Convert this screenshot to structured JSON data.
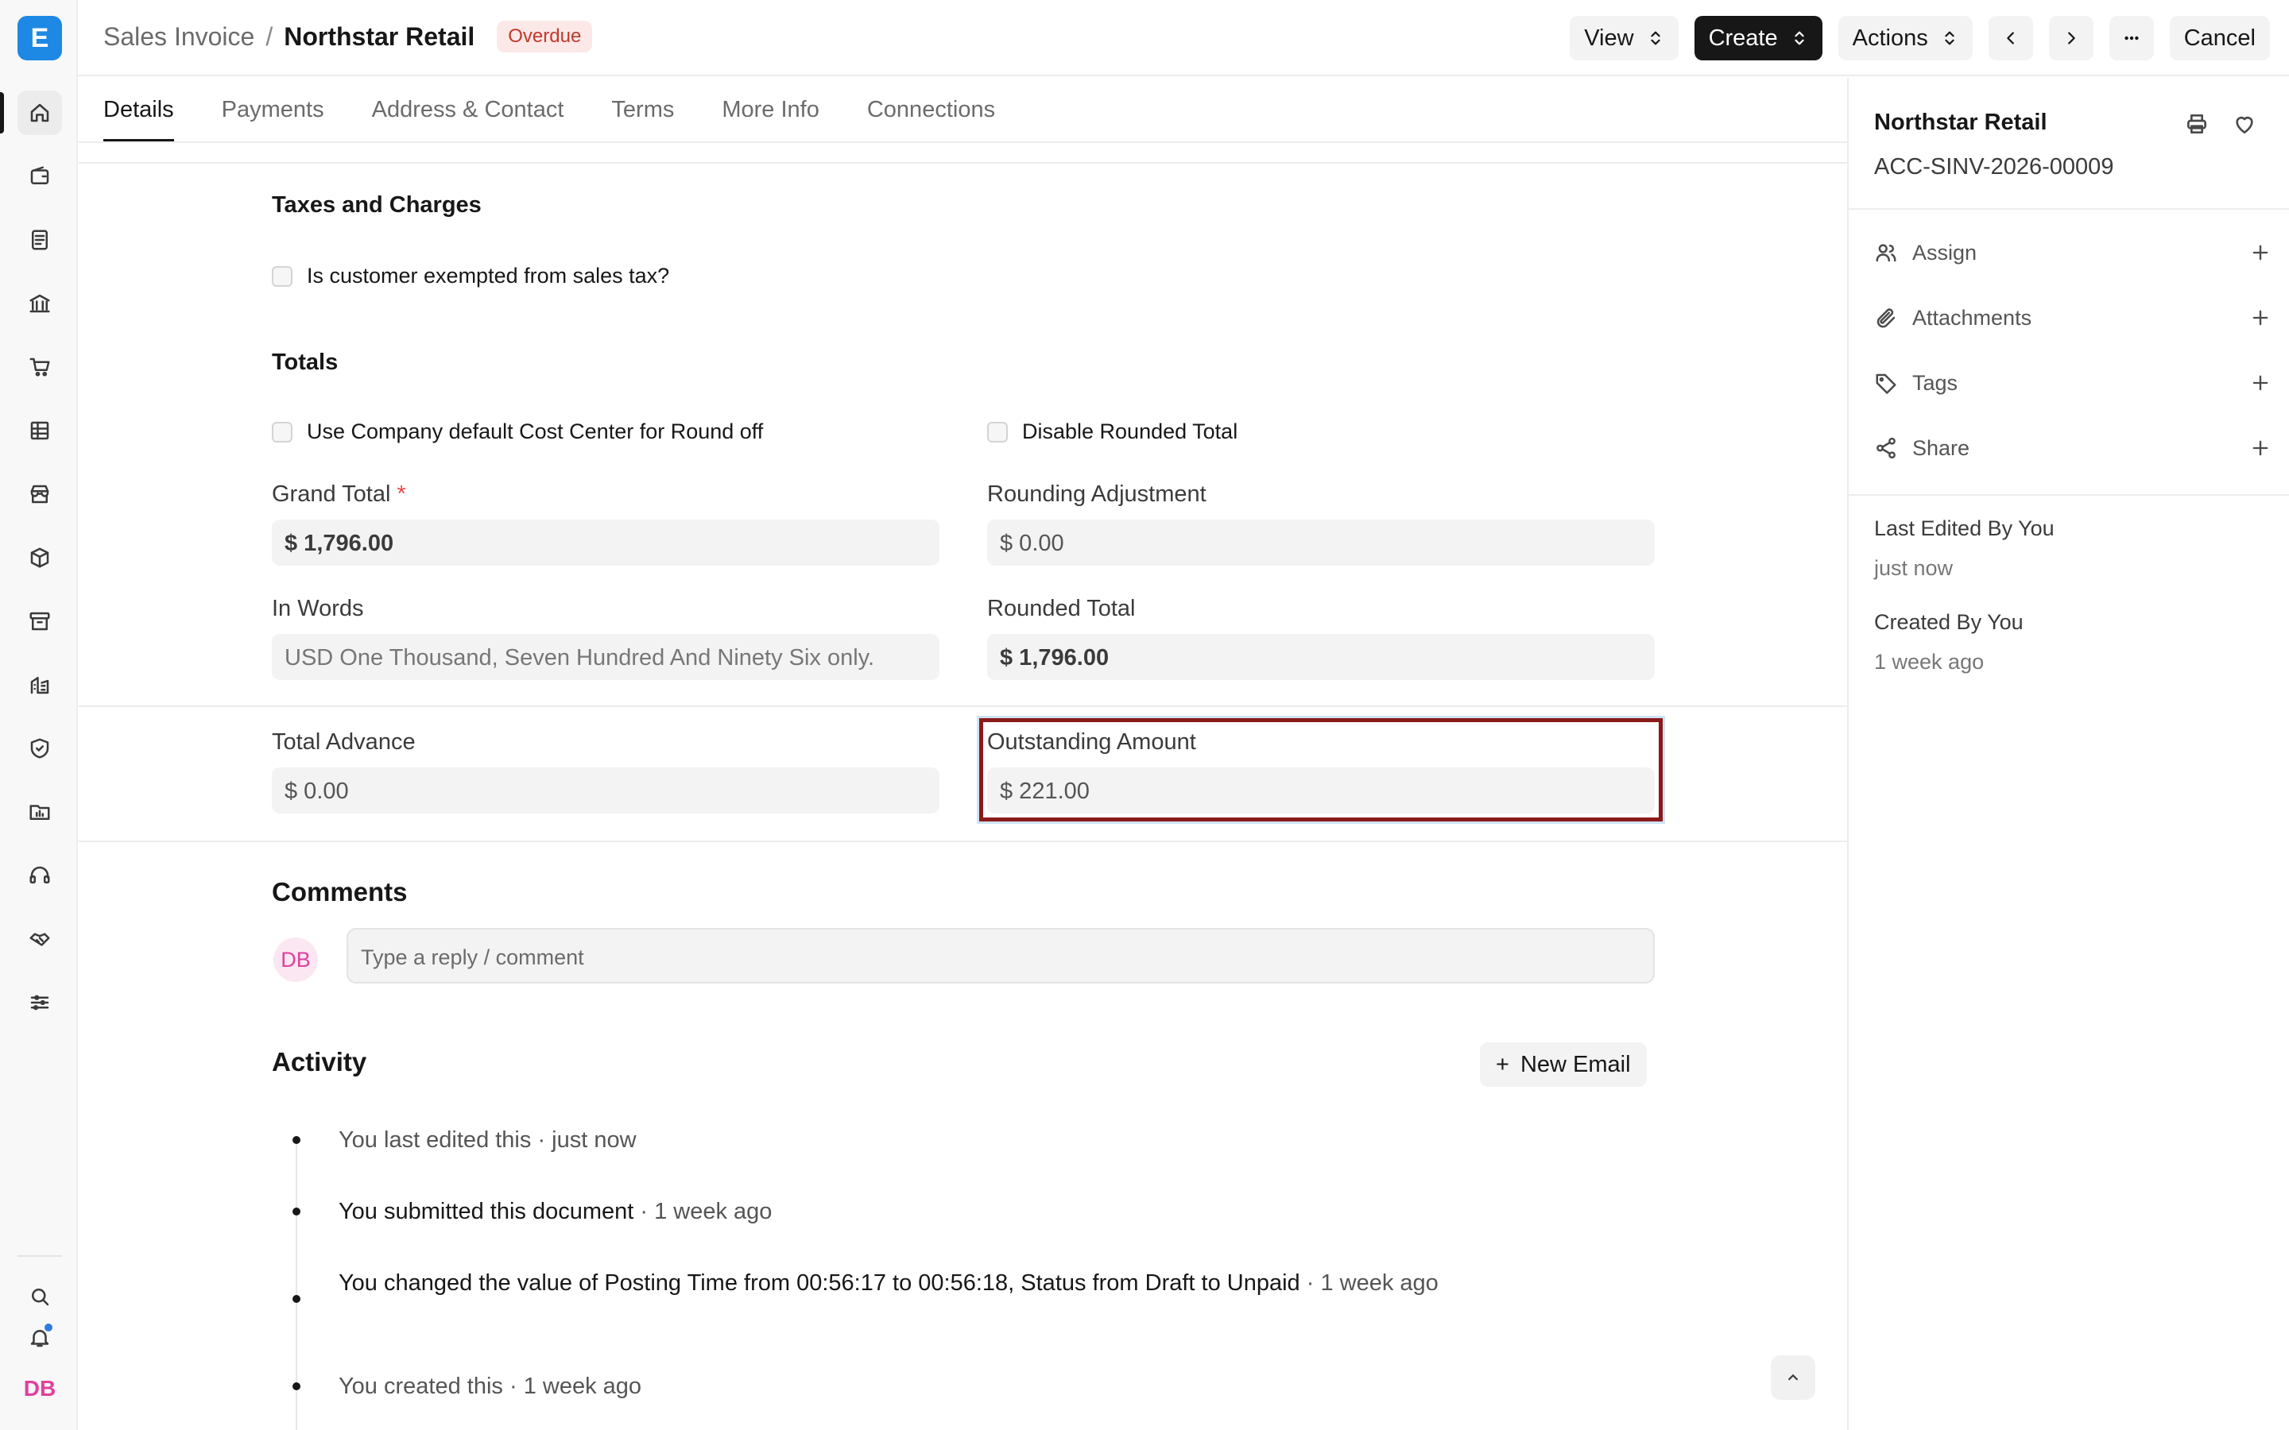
{
  "app": {
    "logo_letter": "E"
  },
  "header": {
    "breadcrumb_parent": "Sales Invoice",
    "breadcrumb_separator": "/",
    "title": "Northstar Retail",
    "status_badge": "Overdue",
    "buttons": {
      "view": "View",
      "create": "Create",
      "actions": "Actions",
      "cancel": "Cancel"
    }
  },
  "tabs": [
    {
      "label": "Details",
      "active": true
    },
    {
      "label": "Payments"
    },
    {
      "label": "Address & Contact"
    },
    {
      "label": "Terms"
    },
    {
      "label": "More Info"
    },
    {
      "label": "Connections"
    }
  ],
  "taxes": {
    "heading": "Taxes and Charges",
    "exempt_checkbox": "Is customer exempted from sales tax?"
  },
  "totals": {
    "heading": "Totals",
    "cost_center_checkbox": "Use Company default Cost Center for Round off",
    "disable_rounded_checkbox": "Disable Rounded Total",
    "grand_total_label": "Grand Total",
    "required_mark": "*",
    "grand_total_value": "$ 1,796.00",
    "rounding_adjustment_label": "Rounding Adjustment",
    "rounding_adjustment_value": "$ 0.00",
    "in_words_label": "In Words",
    "in_words_value": "USD One Thousand, Seven Hundred And Ninety Six only.",
    "rounded_total_label": "Rounded Total",
    "rounded_total_value": "$ 1,796.00",
    "total_advance_label": "Total Advance",
    "total_advance_value": "$ 0.00",
    "outstanding_label": "Outstanding Amount",
    "outstanding_value": "$ 221.00"
  },
  "comments": {
    "heading": "Comments",
    "avatar_initials": "DB",
    "placeholder": "Type a reply / comment"
  },
  "activity": {
    "heading": "Activity",
    "new_email": "New Email",
    "items": [
      {
        "action": "You last edited this",
        "time": " · just now"
      },
      {
        "action": "You submitted this document",
        "time": " · 1 week ago"
      },
      {
        "prefix": "You changed the value of Posting Time from ",
        "old_time": "00:56:17",
        "to1": " to ",
        "new_time": "00:56:18",
        "mid": ", Status from ",
        "old_status": "Draft",
        "to2": " to ",
        "new_status": "Unpaid",
        "time": " · 1 week ago"
      },
      {
        "action": "You created this",
        "time": " · 1 week ago"
      }
    ]
  },
  "sidebar": {
    "title": "Northstar Retail",
    "doc_id": "ACC-SINV-2026-00009",
    "rows": {
      "assign": "Assign",
      "attachments": "Attachments",
      "tags": "Tags",
      "share": "Share"
    },
    "last_edited_label": "Last Edited By You",
    "last_edited_value": "just now",
    "created_label": "Created By You",
    "created_value": "1 week ago"
  },
  "user": {
    "initials": "DB"
  },
  "colors": {
    "accent": "#1e88e5",
    "highlight_border": "#8b1a1a",
    "badge_text": "#c0392b",
    "avatar_pink": "#e0409c"
  }
}
